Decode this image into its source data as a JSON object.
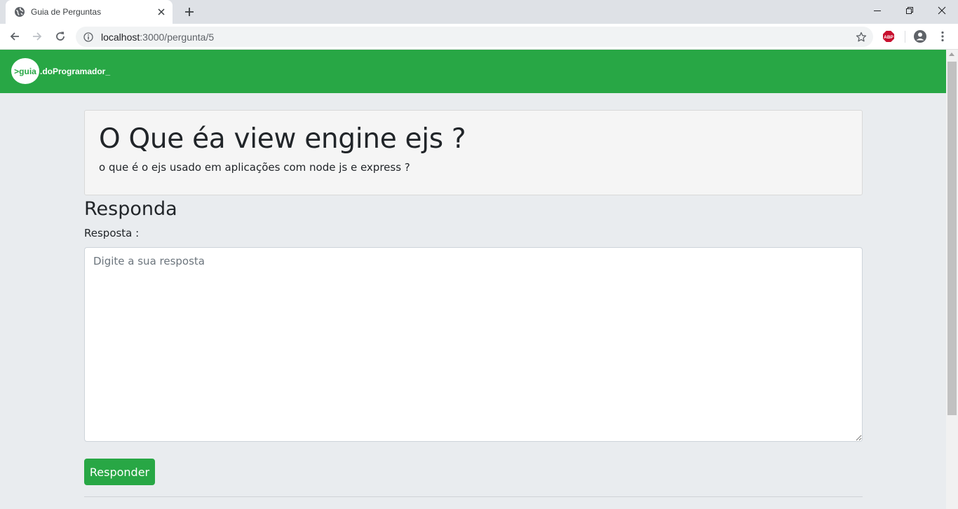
{
  "browser": {
    "tab": {
      "title": "Guia de Perguntas",
      "favicon": "globe-icon",
      "close_icon": "close-icon"
    },
    "new_tab_icon": "plus-icon",
    "window_controls": [
      "minimize-icon",
      "restore-icon",
      "close-icon"
    ],
    "toolbar": {
      "back_icon": "arrow-left-icon",
      "forward_icon": "arrow-right-icon",
      "reload_icon": "reload-icon",
      "url_host": "localhost",
      "url_path": ":3000/pergunta/5",
      "bookmark_icon": "star-icon",
      "extension_label": "ABP",
      "profile_icon": "account-icon",
      "menu_icon": "kebab-menu-icon"
    }
  },
  "navbar": {
    "brand_prefix": ">guia",
    "brand_text": ".doProgramador",
    "brand_underscore": "_",
    "color": "#28a745"
  },
  "question": {
    "title": "O Que éa view engine ejs ?",
    "description": "o que é o ejs usado em aplicações com node js e express ?"
  },
  "answer_form": {
    "heading": "Responda",
    "label": "Resposta :",
    "placeholder": "Digite a sua resposta",
    "value": "",
    "submit_label": "Responder",
    "button_color": "#28a745"
  }
}
